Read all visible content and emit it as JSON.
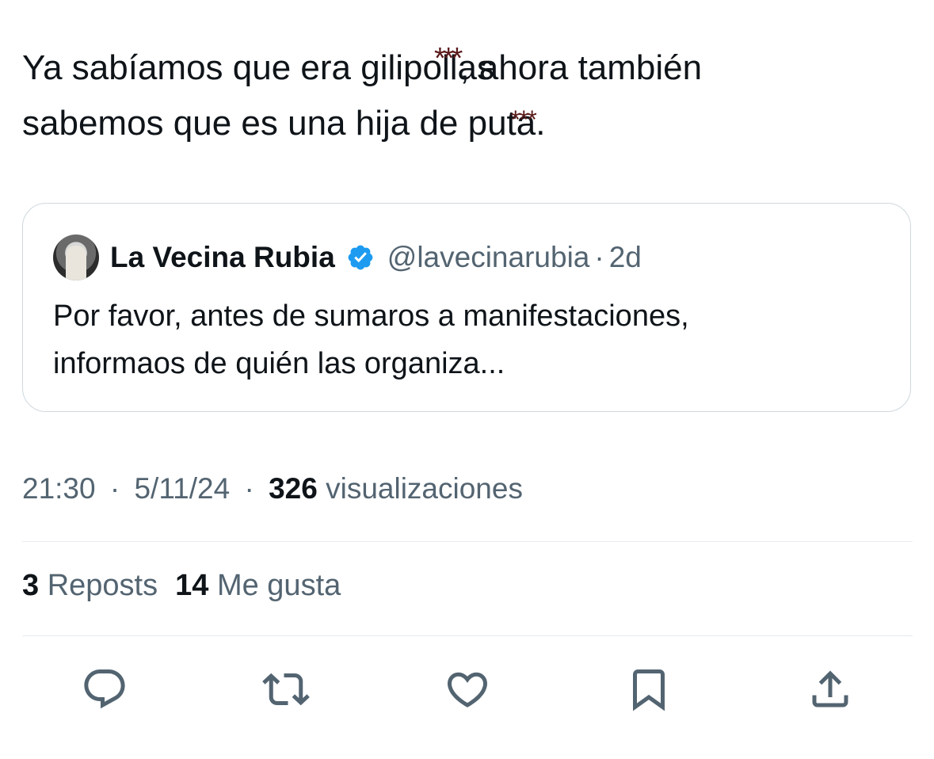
{
  "tweet": {
    "line1_before": "Ya sabíamos que era gilipollas",
    "line1_stars": "***",
    "line1_after": ", ahora también",
    "line2_before": "sabemos que es una hija de puta.",
    "line2_stars": "***"
  },
  "quoted_tweet": {
    "author_name": "La Vecina Rubia",
    "handle": "@lavecinarubia",
    "separator": "·",
    "time": "2d",
    "line1": "Por favor, antes de sumaros a manifestaciones,",
    "line2": "informaos de quién las organiza..."
  },
  "meta": {
    "time": "21:30",
    "separator": "·",
    "date": "5/11/24",
    "views_count": "326",
    "views_label": "visualizaciones"
  },
  "stats": {
    "reposts_count": "3",
    "reposts_label": "Reposts",
    "likes_count": "14",
    "likes_label": "Me gusta"
  },
  "actions": [
    "reply-icon",
    "repost-icon",
    "like-icon",
    "bookmark-icon",
    "share-icon"
  ],
  "colors": {
    "text": "#0f1419",
    "secondary": "#536471",
    "verified": "#1d9bf0",
    "border": "#cfd9de",
    "annotation": "#5a1a1a"
  }
}
